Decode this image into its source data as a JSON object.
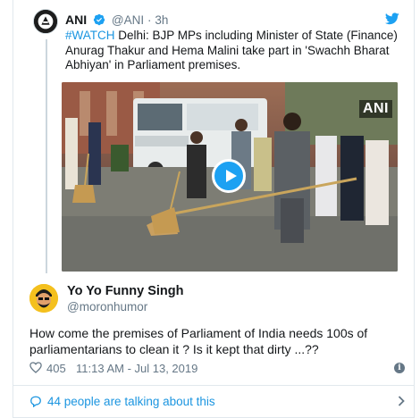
{
  "quoted_tweet": {
    "author_name": "ANI",
    "handle": "@ANI",
    "separator": "·",
    "time": "3h",
    "hashtag": "#WATCH",
    "text_rest": " Delhi: BJP MPs including Minister of State (Finance) Anurag Thakur and Hema Malini take part in 'Swachh Bharat Abhiyan' in Parliament premises.",
    "media": {
      "watermark": "ANI"
    }
  },
  "tweet": {
    "author_name": "Yo Yo Funny Singh",
    "handle": "@moronhumor",
    "text": "How come the premises of Parliament of India needs 100s of parliamentarians to clean it ? Is it kept that dirty ...??",
    "likes": "405",
    "timestamp": "11:13 AM - Jul 13, 2019",
    "info_glyph": "i"
  },
  "footer": {
    "talking": "44 people are talking about this"
  },
  "colors": {
    "link_blue": "#1b95e0",
    "twitter_blue": "#1da1f2",
    "muted_gray": "#657786",
    "border": "#e1e8ed"
  },
  "icons": [
    "verified-icon",
    "twitter-bird-icon",
    "play-icon",
    "heart-icon",
    "info-icon",
    "comment-bubble-icon",
    "chevron-right-icon"
  ]
}
